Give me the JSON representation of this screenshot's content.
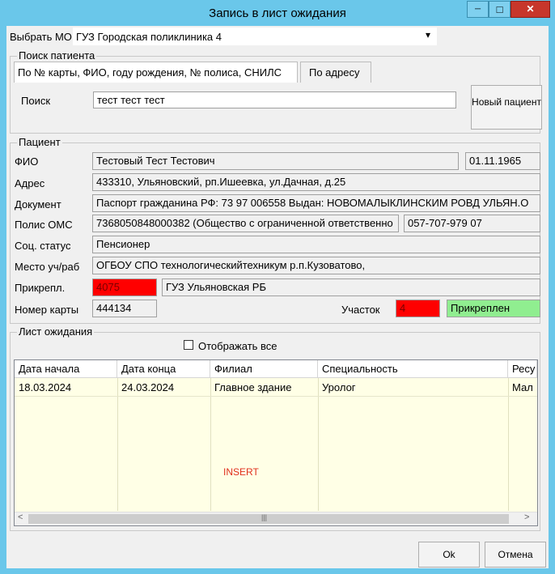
{
  "window": {
    "title": "Запись в лист ожидания",
    "controls": {
      "minimize": "─",
      "maximize": "□",
      "close": "✕"
    }
  },
  "mo": {
    "label": "Выбрать МО",
    "value": "ГУЗ Городская поликлиника 4",
    "arrow": "▾"
  },
  "search": {
    "group_title": "Поиск патиента",
    "tab_main": "По № карты, ФИО, году рождения, № полиса, СНИЛС",
    "tab_address": "По адресу",
    "label": "Поиск",
    "value": "тест тест тест",
    "new_patient_label": "Новый пациент"
  },
  "patient": {
    "group_title": "Пациент",
    "fio_label": "ФИО",
    "fio": "Тестовый Тест Тестович",
    "birthdate": "01.11.1965",
    "address_label": "Адрес",
    "address": "433310, Ульяновский, рп.Ишеевка, ул.Дачная, д.25",
    "document_label": "Документ",
    "document": "Паспорт гражданина РФ: 73 97 006558 Выдан: НОВОМАЛЫКЛИНСКИМ  РОВД УЛЬЯН.О",
    "oms_label": "Полис ОМС",
    "oms": "7368050848000382 (Общество с ограниченной ответственно",
    "snils": "057-707-979 07",
    "social_label": "Соц. статус",
    "social": "Пенсионер",
    "work_label": "Место уч/раб",
    "work": "ОГБОУ СПО технологическийтехникум р.п.Кузоватово,",
    "attach_label": "Прикрепл.",
    "attach_code": "4075",
    "attach_org": "ГУЗ Ульяновская РБ",
    "card_label": "Номер карты",
    "card": "444134",
    "district_label": "Участок",
    "district": "4",
    "attach_status": "Прикреплен"
  },
  "waitlist": {
    "group_title": "Лист ожидания",
    "show_all_label": "Отображать все",
    "columns": [
      "Дата начала",
      "Дата конца",
      "Филиал",
      "Специальность",
      "Ресу"
    ],
    "rows": [
      [
        "18.03.2024",
        "24.03.2024",
        "Главное здание",
        "Уролог",
        "Мал"
      ]
    ],
    "status_text": "INSERT",
    "scroll_left": "<",
    "scroll_right": ">",
    "scroll_thumb": "|||"
  },
  "buttons": {
    "ok": "Ok",
    "cancel": "Отмена"
  },
  "colors": {
    "title_bg": "#6ac7ea",
    "red_field": "#ff0000",
    "green_field": "#90ee90",
    "grid_bg": "#ffffe6",
    "insert_text": "#e0301e"
  }
}
